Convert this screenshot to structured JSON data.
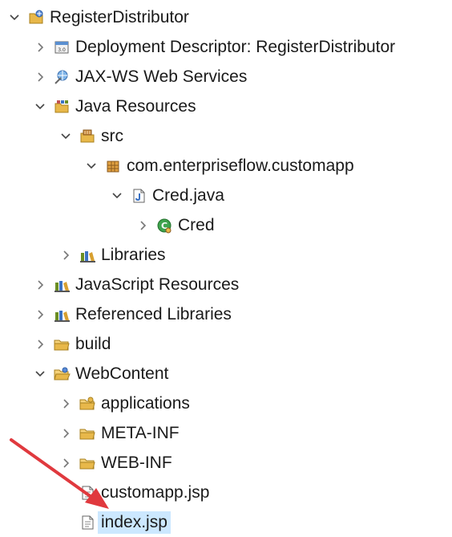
{
  "tree": {
    "items": [
      {
        "label": "RegisterDistributor",
        "level": 0,
        "expanded": true,
        "icon": "web-project-icon"
      },
      {
        "label": "Deployment Descriptor: RegisterDistributor",
        "level": 1,
        "expanded": false,
        "icon": "deployment-descriptor-icon"
      },
      {
        "label": "JAX-WS Web Services",
        "level": 1,
        "expanded": false,
        "icon": "web-services-icon"
      },
      {
        "label": "Java Resources",
        "level": 1,
        "expanded": true,
        "icon": "java-resources-icon"
      },
      {
        "label": "src",
        "level": 2,
        "expanded": true,
        "icon": "source-folder-icon"
      },
      {
        "label": "com.enterpriseflow.customapp",
        "level": 3,
        "expanded": true,
        "icon": "package-icon"
      },
      {
        "label": "Cred.java",
        "level": 4,
        "expanded": true,
        "icon": "java-file-icon"
      },
      {
        "label": "Cred",
        "level": 5,
        "expanded": false,
        "icon": "class-icon"
      },
      {
        "label": "Libraries",
        "level": 2,
        "expanded": false,
        "icon": "library-icon"
      },
      {
        "label": "JavaScript Resources",
        "level": 1,
        "expanded": false,
        "icon": "library-icon"
      },
      {
        "label": "Referenced Libraries",
        "level": 1,
        "expanded": false,
        "icon": "library-icon"
      },
      {
        "label": "build",
        "level": 1,
        "expanded": false,
        "icon": "folder-icon"
      },
      {
        "label": "WebContent",
        "level": 1,
        "expanded": true,
        "icon": "folder-open-icon"
      },
      {
        "label": "applications",
        "level": 2,
        "expanded": false,
        "icon": "folder-icon"
      },
      {
        "label": "META-INF",
        "level": 2,
        "expanded": false,
        "icon": "folder-icon"
      },
      {
        "label": "WEB-INF",
        "level": 2,
        "expanded": false,
        "icon": "folder-icon"
      },
      {
        "label": "customapp.jsp",
        "level": 2,
        "leaf": true,
        "icon": "jsp-file-icon"
      },
      {
        "label": "index.jsp",
        "level": 2,
        "leaf": true,
        "selected": true,
        "icon": "jsp-file-icon"
      }
    ]
  },
  "colors": {
    "selection": "#cce8ff",
    "annotation_arrow": "#e0393e",
    "folder": "#e8b84a",
    "library": "#6b8e23",
    "java": "#3b72c4"
  }
}
